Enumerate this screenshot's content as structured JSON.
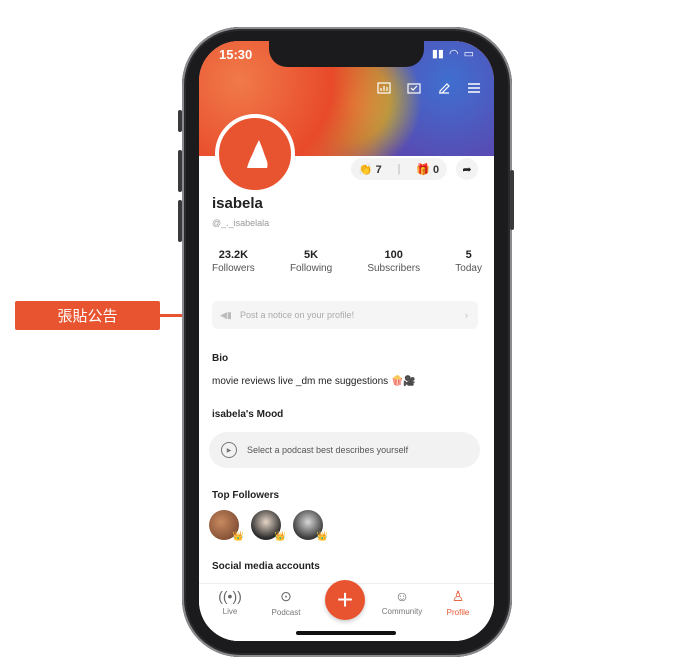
{
  "callout": {
    "label": "張貼公告"
  },
  "status": {
    "time": "15:30"
  },
  "profile": {
    "name": "isabela",
    "handle": "@_._isabelala",
    "likes": "7",
    "gifts": "0"
  },
  "stats": [
    {
      "value": "23.2K",
      "label": "Followers"
    },
    {
      "value": "5K",
      "label": "Following"
    },
    {
      "value": "100",
      "label": "Subscribers"
    },
    {
      "value": "5",
      "label": "Today"
    }
  ],
  "notice": {
    "placeholder": "Post a notice on your profile!"
  },
  "bio": {
    "title": "Bio",
    "text": "movie reviews live _dm me suggestions 🍿🎥"
  },
  "mood": {
    "title": "isabela's Mood",
    "prompt": "Select a podcast best describes yourself"
  },
  "top_followers": {
    "title": "Top Followers"
  },
  "social": {
    "title": "Social media accounts"
  },
  "tabs": {
    "live": "Live",
    "podcast": "Podcast",
    "community": "Community",
    "profile": "Profile"
  },
  "colors": {
    "accent": "#e8542f"
  },
  "icons": [
    "stats-icon",
    "calendar-icon",
    "edit-icon",
    "menu-icon",
    "megaphone-icon",
    "play-icon",
    "share-icon",
    "gift-icon"
  ]
}
